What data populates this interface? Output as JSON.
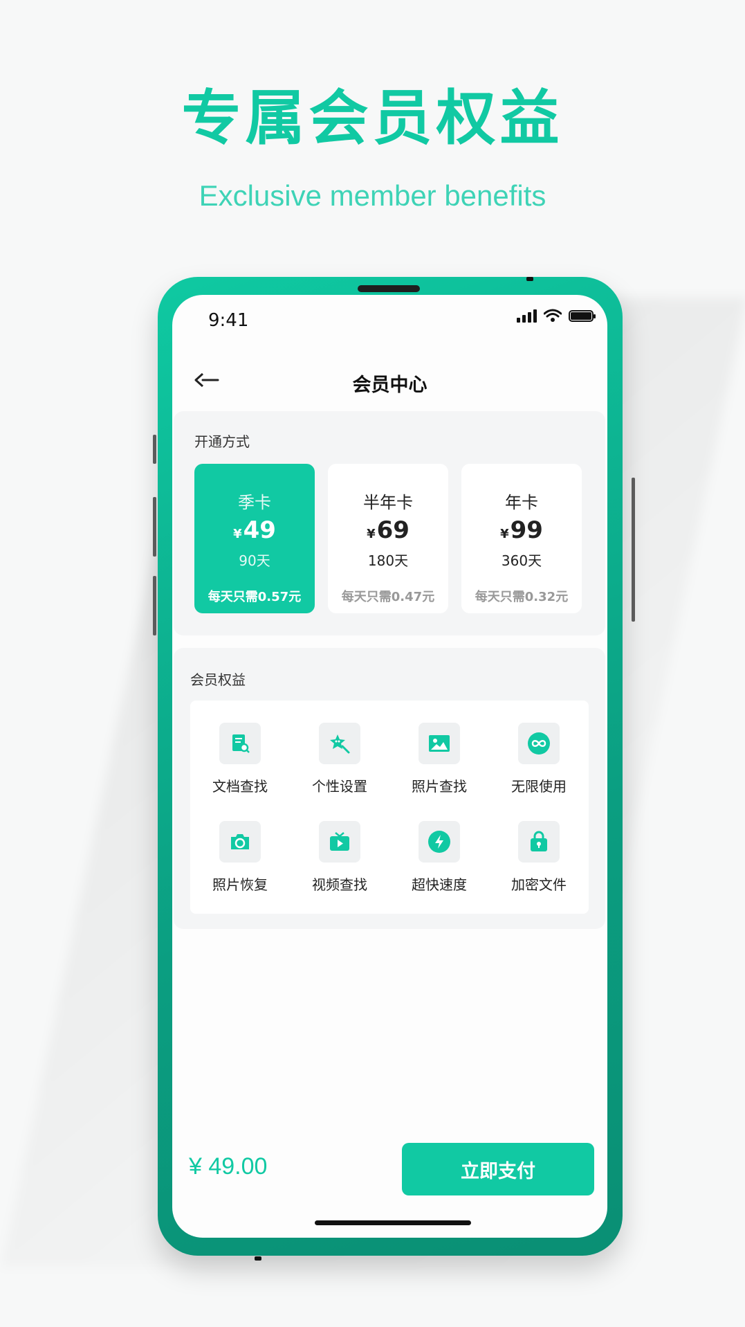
{
  "hero": {
    "title": "专属会员权益",
    "subtitle": "Exclusive member benefits"
  },
  "status_bar": {
    "time": "9:41"
  },
  "nav": {
    "title": "会员中心",
    "back_icon": "back-arrow-icon"
  },
  "plans_section": {
    "title": "开通方式",
    "currency": "¥",
    "plans": [
      {
        "name": "季卡",
        "price": "49",
        "days": "90天",
        "daily": "每天只需0.57元",
        "selected": true
      },
      {
        "name": "半年卡",
        "price": "69",
        "days": "180天",
        "daily": "每天只需0.47元",
        "selected": false
      },
      {
        "name": "年卡",
        "price": "99",
        "days": "360天",
        "daily": "每天只需0.32元",
        "selected": false
      }
    ]
  },
  "benefits_section": {
    "title": "会员权益",
    "items": [
      {
        "label": "文档查找",
        "icon": "document-search-icon"
      },
      {
        "label": "个性设置",
        "icon": "star-wand-icon"
      },
      {
        "label": "照片查找",
        "icon": "image-icon"
      },
      {
        "label": "无限使用",
        "icon": "infinity-icon"
      },
      {
        "label": "照片恢复",
        "icon": "camera-icon"
      },
      {
        "label": "视频查找",
        "icon": "tv-play-icon"
      },
      {
        "label": "超快速度",
        "icon": "lightning-icon"
      },
      {
        "label": "加密文件",
        "icon": "lock-bag-icon"
      }
    ]
  },
  "footer": {
    "total": "¥ 49.00",
    "pay_label": "立即支付"
  },
  "colors": {
    "accent": "#11c9a3",
    "phone_frame": "#0b9e81"
  }
}
